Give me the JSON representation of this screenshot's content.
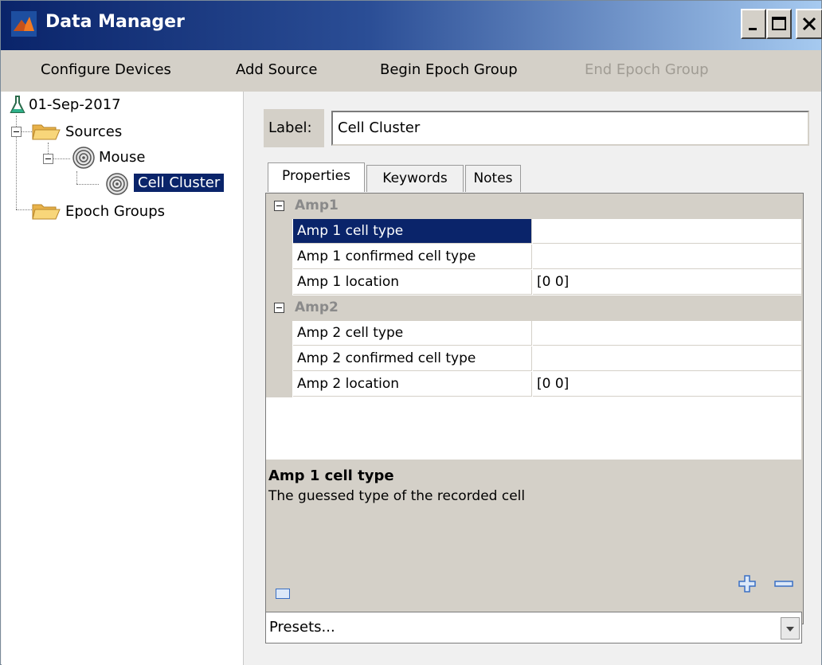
{
  "window": {
    "title": "Data Manager",
    "controls": {
      "minimize": "_",
      "maximize": "□",
      "close": "X"
    }
  },
  "menubar": {
    "items": [
      {
        "label": "Configure Devices",
        "enabled": true
      },
      {
        "label": "Add Source",
        "enabled": true
      },
      {
        "label": "Begin Epoch Group",
        "enabled": true
      },
      {
        "label": "End Epoch Group",
        "enabled": false
      }
    ]
  },
  "tree": {
    "root": "01-Sep-2017",
    "sources": "Sources",
    "mouse": "Mouse",
    "cell_cluster": "Cell Cluster",
    "epoch_groups": "Epoch Groups",
    "selected": "Cell Cluster"
  },
  "detail": {
    "label_caption": "Label:",
    "label_value": "Cell Cluster",
    "tabs": [
      {
        "label": "Properties",
        "active": true
      },
      {
        "label": "Keywords",
        "active": false
      },
      {
        "label": "Notes",
        "active": false
      }
    ],
    "categories": [
      {
        "name": "Amp1",
        "rows": [
          {
            "name": "Amp 1 cell type",
            "value": "",
            "selected": true
          },
          {
            "name": "Amp 1 confirmed cell type",
            "value": "",
            "selected": false
          },
          {
            "name": "Amp 1 location",
            "value": "[0 0]",
            "selected": false
          }
        ]
      },
      {
        "name": "Amp2",
        "rows": [
          {
            "name": "Amp 2 cell type",
            "value": "",
            "selected": false
          },
          {
            "name": "Amp 2 confirmed cell type",
            "value": "",
            "selected": false
          },
          {
            "name": "Amp 2 location",
            "value": "[0 0]",
            "selected": false
          }
        ]
      }
    ],
    "description": {
      "title": "Amp 1 cell type",
      "text": "The guessed type of the recorded cell"
    },
    "toolbar": {
      "keyboard_icon": "keyboard-icon",
      "add_icon": "plus-icon",
      "remove_icon": "minus-icon"
    },
    "presets": {
      "value": "Presets..."
    }
  },
  "colors": {
    "titlebar_start": "#0a246a",
    "titlebar_end": "#a6caf0",
    "selection": "#0a246a",
    "toolbar_icon": "#3a6fc4"
  }
}
